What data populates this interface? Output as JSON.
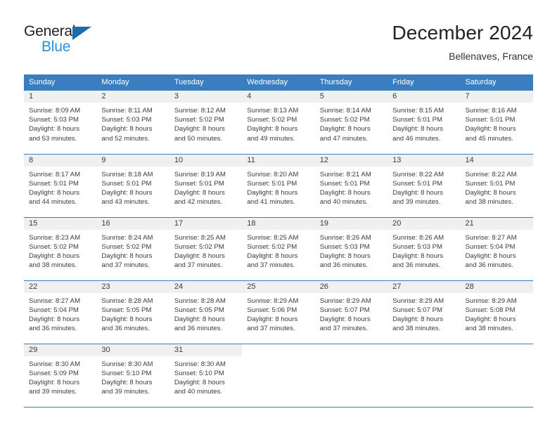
{
  "brand": {
    "name_part1": "General",
    "name_part2": "Blue",
    "triangle_color": "#1b6ca8",
    "blue_color": "#2b8fd4"
  },
  "header": {
    "title": "December 2024",
    "location": "Bellenaves, France"
  },
  "calendar": {
    "accent_color": "#3a7ebf",
    "daynum_band_color": "#f0f0f0",
    "weekday_headers": [
      "Sunday",
      "Monday",
      "Tuesday",
      "Wednesday",
      "Thursday",
      "Friday",
      "Saturday"
    ],
    "weeks": [
      [
        {
          "day": "1",
          "sunrise": "Sunrise: 8:09 AM",
          "sunset": "Sunset: 5:03 PM",
          "daylight1": "Daylight: 8 hours",
          "daylight2": "and 53 minutes."
        },
        {
          "day": "2",
          "sunrise": "Sunrise: 8:11 AM",
          "sunset": "Sunset: 5:03 PM",
          "daylight1": "Daylight: 8 hours",
          "daylight2": "and 52 minutes."
        },
        {
          "day": "3",
          "sunrise": "Sunrise: 8:12 AM",
          "sunset": "Sunset: 5:02 PM",
          "daylight1": "Daylight: 8 hours",
          "daylight2": "and 50 minutes."
        },
        {
          "day": "4",
          "sunrise": "Sunrise: 8:13 AM",
          "sunset": "Sunset: 5:02 PM",
          "daylight1": "Daylight: 8 hours",
          "daylight2": "and 49 minutes."
        },
        {
          "day": "5",
          "sunrise": "Sunrise: 8:14 AM",
          "sunset": "Sunset: 5:02 PM",
          "daylight1": "Daylight: 8 hours",
          "daylight2": "and 47 minutes."
        },
        {
          "day": "6",
          "sunrise": "Sunrise: 8:15 AM",
          "sunset": "Sunset: 5:01 PM",
          "daylight1": "Daylight: 8 hours",
          "daylight2": "and 46 minutes."
        },
        {
          "day": "7",
          "sunrise": "Sunrise: 8:16 AM",
          "sunset": "Sunset: 5:01 PM",
          "daylight1": "Daylight: 8 hours",
          "daylight2": "and 45 minutes."
        }
      ],
      [
        {
          "day": "8",
          "sunrise": "Sunrise: 8:17 AM",
          "sunset": "Sunset: 5:01 PM",
          "daylight1": "Daylight: 8 hours",
          "daylight2": "and 44 minutes."
        },
        {
          "day": "9",
          "sunrise": "Sunrise: 8:18 AM",
          "sunset": "Sunset: 5:01 PM",
          "daylight1": "Daylight: 8 hours",
          "daylight2": "and 43 minutes."
        },
        {
          "day": "10",
          "sunrise": "Sunrise: 8:19 AM",
          "sunset": "Sunset: 5:01 PM",
          "daylight1": "Daylight: 8 hours",
          "daylight2": "and 42 minutes."
        },
        {
          "day": "11",
          "sunrise": "Sunrise: 8:20 AM",
          "sunset": "Sunset: 5:01 PM",
          "daylight1": "Daylight: 8 hours",
          "daylight2": "and 41 minutes."
        },
        {
          "day": "12",
          "sunrise": "Sunrise: 8:21 AM",
          "sunset": "Sunset: 5:01 PM",
          "daylight1": "Daylight: 8 hours",
          "daylight2": "and 40 minutes."
        },
        {
          "day": "13",
          "sunrise": "Sunrise: 8:22 AM",
          "sunset": "Sunset: 5:01 PM",
          "daylight1": "Daylight: 8 hours",
          "daylight2": "and 39 minutes."
        },
        {
          "day": "14",
          "sunrise": "Sunrise: 8:22 AM",
          "sunset": "Sunset: 5:01 PM",
          "daylight1": "Daylight: 8 hours",
          "daylight2": "and 38 minutes."
        }
      ],
      [
        {
          "day": "15",
          "sunrise": "Sunrise: 8:23 AM",
          "sunset": "Sunset: 5:02 PM",
          "daylight1": "Daylight: 8 hours",
          "daylight2": "and 38 minutes."
        },
        {
          "day": "16",
          "sunrise": "Sunrise: 8:24 AM",
          "sunset": "Sunset: 5:02 PM",
          "daylight1": "Daylight: 8 hours",
          "daylight2": "and 37 minutes."
        },
        {
          "day": "17",
          "sunrise": "Sunrise: 8:25 AM",
          "sunset": "Sunset: 5:02 PM",
          "daylight1": "Daylight: 8 hours",
          "daylight2": "and 37 minutes."
        },
        {
          "day": "18",
          "sunrise": "Sunrise: 8:25 AM",
          "sunset": "Sunset: 5:02 PM",
          "daylight1": "Daylight: 8 hours",
          "daylight2": "and 37 minutes."
        },
        {
          "day": "19",
          "sunrise": "Sunrise: 8:26 AM",
          "sunset": "Sunset: 5:03 PM",
          "daylight1": "Daylight: 8 hours",
          "daylight2": "and 36 minutes."
        },
        {
          "day": "20",
          "sunrise": "Sunrise: 8:26 AM",
          "sunset": "Sunset: 5:03 PM",
          "daylight1": "Daylight: 8 hours",
          "daylight2": "and 36 minutes."
        },
        {
          "day": "21",
          "sunrise": "Sunrise: 8:27 AM",
          "sunset": "Sunset: 5:04 PM",
          "daylight1": "Daylight: 8 hours",
          "daylight2": "and 36 minutes."
        }
      ],
      [
        {
          "day": "22",
          "sunrise": "Sunrise: 8:27 AM",
          "sunset": "Sunset: 5:04 PM",
          "daylight1": "Daylight: 8 hours",
          "daylight2": "and 36 minutes."
        },
        {
          "day": "23",
          "sunrise": "Sunrise: 8:28 AM",
          "sunset": "Sunset: 5:05 PM",
          "daylight1": "Daylight: 8 hours",
          "daylight2": "and 36 minutes."
        },
        {
          "day": "24",
          "sunrise": "Sunrise: 8:28 AM",
          "sunset": "Sunset: 5:05 PM",
          "daylight1": "Daylight: 8 hours",
          "daylight2": "and 36 minutes."
        },
        {
          "day": "25",
          "sunrise": "Sunrise: 8:29 AM",
          "sunset": "Sunset: 5:06 PM",
          "daylight1": "Daylight: 8 hours",
          "daylight2": "and 37 minutes."
        },
        {
          "day": "26",
          "sunrise": "Sunrise: 8:29 AM",
          "sunset": "Sunset: 5:07 PM",
          "daylight1": "Daylight: 8 hours",
          "daylight2": "and 37 minutes."
        },
        {
          "day": "27",
          "sunrise": "Sunrise: 8:29 AM",
          "sunset": "Sunset: 5:07 PM",
          "daylight1": "Daylight: 8 hours",
          "daylight2": "and 38 minutes."
        },
        {
          "day": "28",
          "sunrise": "Sunrise: 8:29 AM",
          "sunset": "Sunset: 5:08 PM",
          "daylight1": "Daylight: 8 hours",
          "daylight2": "and 38 minutes."
        }
      ],
      [
        {
          "day": "29",
          "sunrise": "Sunrise: 8:30 AM",
          "sunset": "Sunset: 5:09 PM",
          "daylight1": "Daylight: 8 hours",
          "daylight2": "and 39 minutes."
        },
        {
          "day": "30",
          "sunrise": "Sunrise: 8:30 AM",
          "sunset": "Sunset: 5:10 PM",
          "daylight1": "Daylight: 8 hours",
          "daylight2": "and 39 minutes."
        },
        {
          "day": "31",
          "sunrise": "Sunrise: 8:30 AM",
          "sunset": "Sunset: 5:10 PM",
          "daylight1": "Daylight: 8 hours",
          "daylight2": "and 40 minutes."
        },
        {
          "day": "",
          "sunrise": "",
          "sunset": "",
          "daylight1": "",
          "daylight2": ""
        },
        {
          "day": "",
          "sunrise": "",
          "sunset": "",
          "daylight1": "",
          "daylight2": ""
        },
        {
          "day": "",
          "sunrise": "",
          "sunset": "",
          "daylight1": "",
          "daylight2": ""
        },
        {
          "day": "",
          "sunrise": "",
          "sunset": "",
          "daylight1": "",
          "daylight2": ""
        }
      ]
    ]
  }
}
